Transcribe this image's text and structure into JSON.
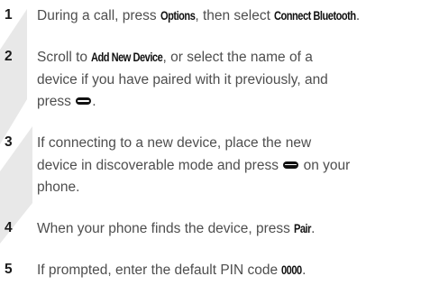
{
  "steps": [
    {
      "number": "1",
      "lines": [
        [
          {
            "t": "text",
            "v": "During a call, press "
          },
          {
            "t": "ui",
            "v": "Options"
          },
          {
            "t": "text",
            "v": ", then select "
          },
          {
            "t": "ui",
            "v": "Connect Bluetooth"
          },
          {
            "t": "text",
            "v": "."
          }
        ]
      ]
    },
    {
      "number": "2",
      "lines": [
        [
          {
            "t": "text",
            "v": "Scroll to "
          },
          {
            "t": "ui",
            "v": "Add New Device"
          },
          {
            "t": "text",
            "v": ", or select the name of a"
          }
        ],
        [
          {
            "t": "text",
            "v": "device if you have paired with it previously, and"
          }
        ],
        [
          {
            "t": "text",
            "v": "press "
          },
          {
            "t": "key",
            "v": "center-key-icon"
          },
          {
            "t": "text",
            "v": "."
          }
        ]
      ]
    },
    {
      "number": "3",
      "lines": [
        [
          {
            "t": "text",
            "v": "If connecting to a new device, place the new"
          }
        ],
        [
          {
            "t": "text",
            "v": "device in discoverable mode and press "
          },
          {
            "t": "key",
            "v": "center-key-icon"
          },
          {
            "t": "text",
            "v": " on your"
          }
        ],
        [
          {
            "t": "text",
            "v": "phone."
          }
        ]
      ]
    },
    {
      "number": "4",
      "lines": [
        [
          {
            "t": "text",
            "v": "When your phone finds the device, press "
          },
          {
            "t": "ui",
            "v": "Pair"
          },
          {
            "t": "text",
            "v": "."
          }
        ]
      ]
    },
    {
      "number": "5",
      "lines": [
        [
          {
            "t": "text",
            "v": "If prompted, enter the default PIN code "
          },
          {
            "t": "ui",
            "v": "0000"
          },
          {
            "t": "text",
            "v": "."
          }
        ]
      ]
    }
  ],
  "colors": {
    "body_text": "#4e4e4e",
    "step_number": "#1a1a1a",
    "ui_term": "#111111",
    "watermark": "#e6e6e6"
  }
}
